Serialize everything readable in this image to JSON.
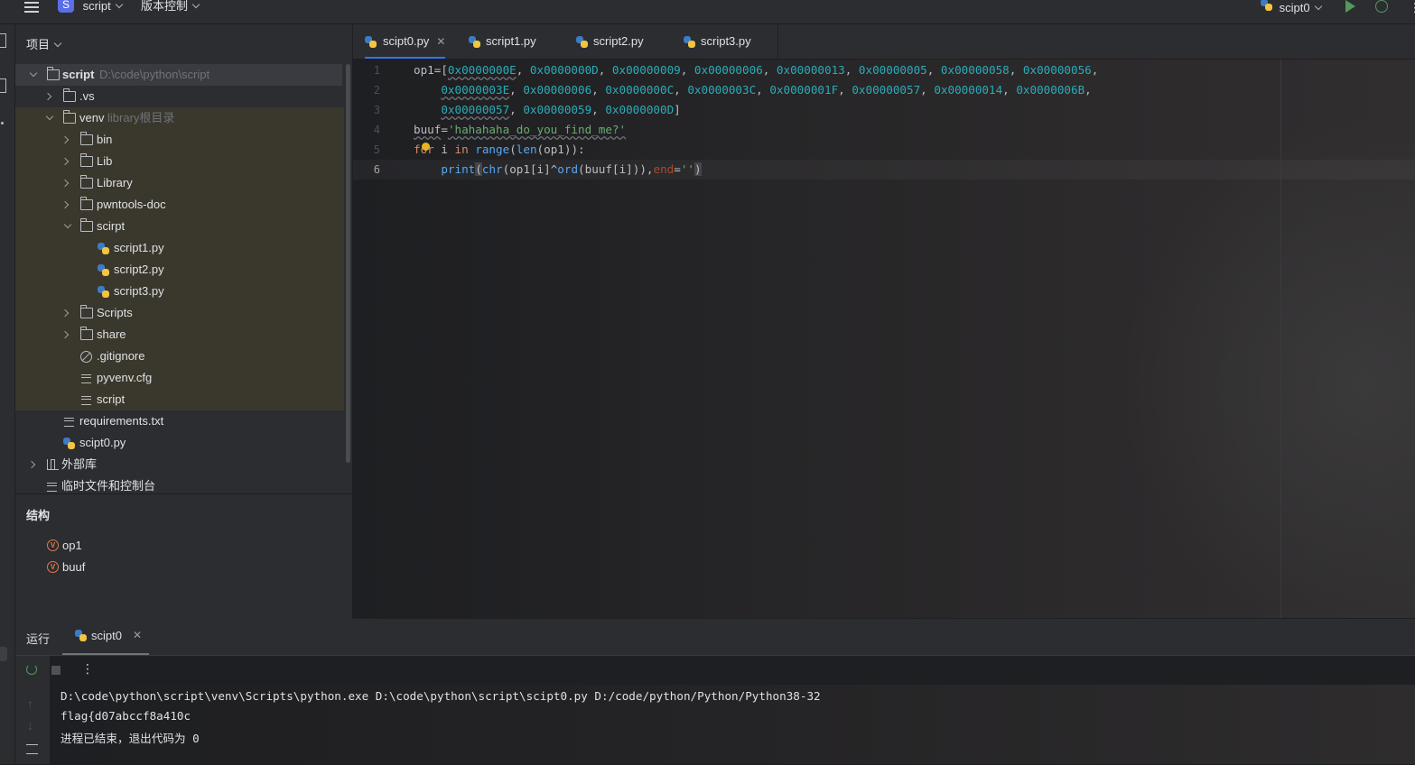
{
  "topbar": {
    "project_badge": "S",
    "project_name": "script",
    "vcs_label": "版本控制",
    "run_config": "scipt0"
  },
  "project_panel": {
    "title": "项目",
    "root": {
      "name": "script",
      "path": "D:\\code\\python\\script"
    },
    "items": [
      {
        "label": ".vs"
      },
      {
        "label": "venv",
        "hint": "library根目录"
      },
      {
        "label": "bin"
      },
      {
        "label": "Lib"
      },
      {
        "label": "Library"
      },
      {
        "label": "pwntools-doc"
      },
      {
        "label": "scirpt"
      },
      {
        "label": "script1.py"
      },
      {
        "label": "script2.py"
      },
      {
        "label": "script3.py"
      },
      {
        "label": "Scripts"
      },
      {
        "label": "share"
      },
      {
        "label": ".gitignore"
      },
      {
        "label": "pyvenv.cfg"
      },
      {
        "label": "script"
      },
      {
        "label": "requirements.txt"
      },
      {
        "label": "scipt0.py"
      },
      {
        "label": "外部库"
      },
      {
        "label": "临时文件和控制台"
      }
    ]
  },
  "tabs": [
    {
      "label": "scipt0.py"
    },
    {
      "label": "script1.py"
    },
    {
      "label": "script2.py"
    },
    {
      "label": "script3.py"
    }
  ],
  "editor": {
    "line_numbers": [
      "1",
      "2",
      "3",
      "4",
      "5",
      "6"
    ],
    "hex": [
      "0x0000000E",
      "0x0000000D",
      "0x00000009",
      "0x00000006",
      "0x00000013",
      "0x00000005",
      "0x00000058",
      "0x00000056",
      "0x0000003E",
      "0x00000006",
      "0x0000000C",
      "0x0000003C",
      "0x0000001F",
      "0x00000057",
      "0x00000014",
      "0x0000006B",
      "0x00000057",
      "0x00000059",
      "0x0000000D"
    ],
    "var_op1": "op1",
    "var_buuf": "buuf",
    "string_literal": "'hahahaha_do_you_find_me?'",
    "kw_for": "for",
    "kw_in": "in",
    "fn_range": "range",
    "fn_len": "len",
    "fn_print": "print",
    "fn_chr": "chr",
    "fn_ord": "ord",
    "param_end": "end",
    "empty_string": "''"
  },
  "structure_panel": {
    "title": "结构",
    "items": [
      {
        "badge": "V",
        "label": "op1"
      },
      {
        "badge": "V",
        "label": "buuf"
      }
    ]
  },
  "run_panel": {
    "title": "运行",
    "tab": "scipt0",
    "output": [
      "D:\\code\\python\\script\\venv\\Scripts\\python.exe D:\\code\\python\\script\\scipt0.py D:/code/python/Python/Python38-32",
      "flag{d07abccf8a410c",
      "进程已结束，退出代码为 0"
    ]
  }
}
